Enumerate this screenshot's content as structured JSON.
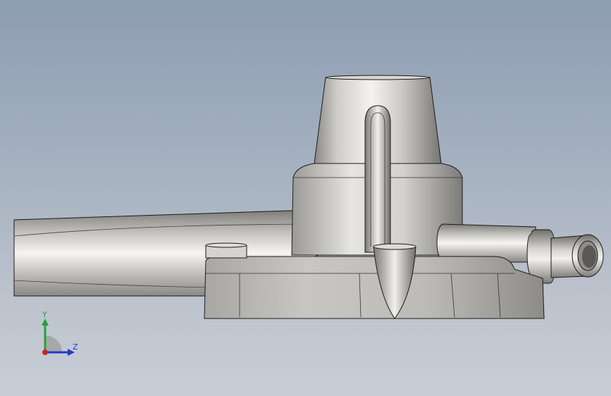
{
  "viewport": {
    "background_top": "#8d9db2",
    "background_bottom": "#c9ced6"
  },
  "model": {
    "part_color": "#c8c6c2",
    "edge_color": "#1a1a1a"
  },
  "triad": {
    "y_label": "Y",
    "z_label": "Z",
    "y_color": "#22a23a",
    "z_color": "#1e3cc8",
    "x_color": "#d02020"
  }
}
